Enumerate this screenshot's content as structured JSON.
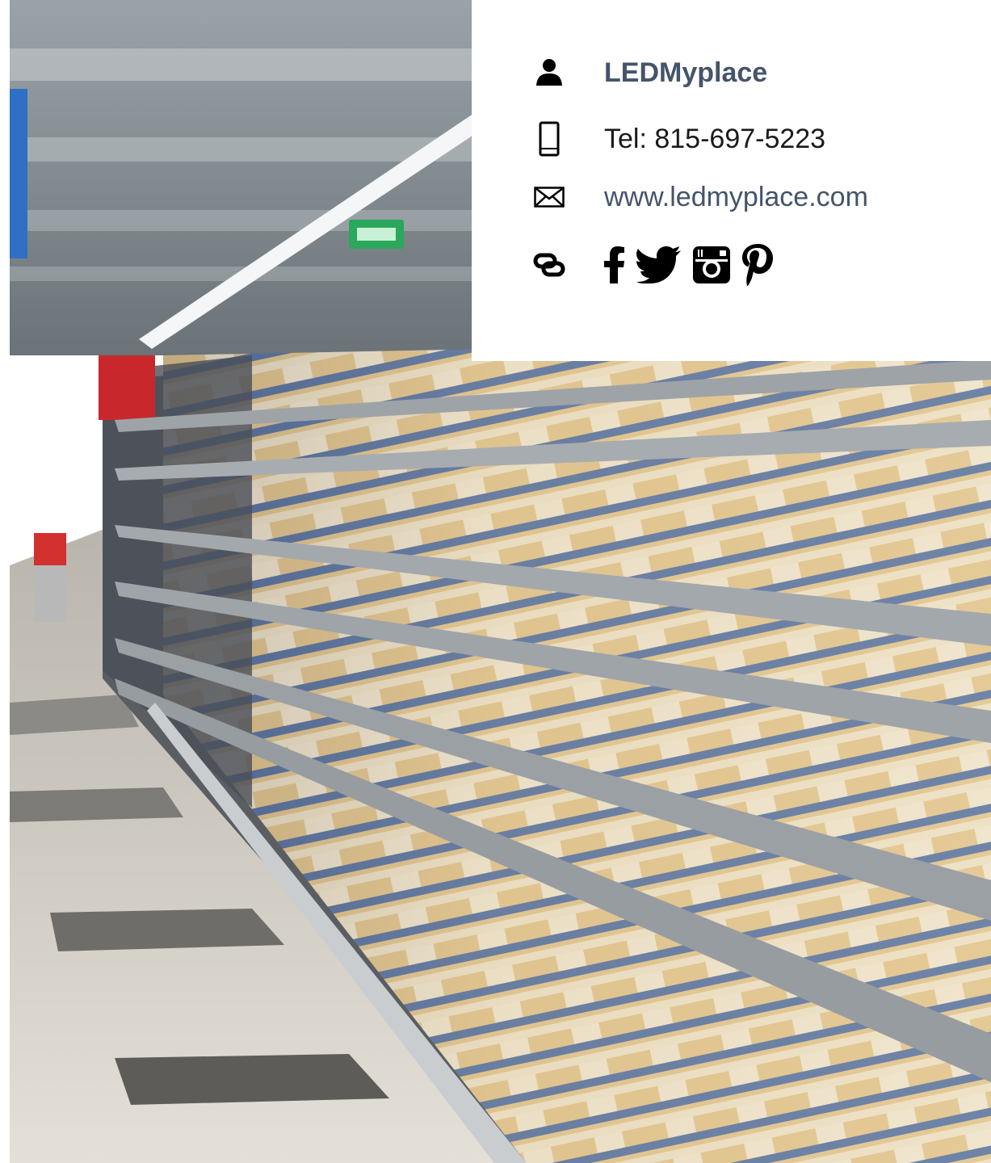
{
  "contact": {
    "name": "LEDMyplace",
    "phone": "Tel: 815-697-5223",
    "website": "www.ledmyplace.com"
  },
  "icons": {
    "name_icon": "person-icon",
    "phone_icon": "mobile-phone-icon",
    "web_icon": "envelope-icon",
    "links_icon": "link-icon",
    "social": [
      "facebook-icon",
      "twitter-icon",
      "instagram-icon",
      "pinterest-icon"
    ]
  },
  "colors": {
    "name": "#44546a",
    "website": "#44546a",
    "phone": "#1a1a1a",
    "icon": "#000000"
  }
}
